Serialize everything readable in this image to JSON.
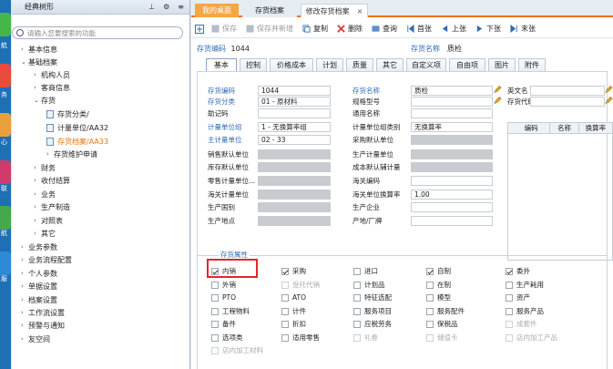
{
  "left_strip": {
    "labels": [
      "航",
      "务",
      "心",
      "联",
      "航",
      "服"
    ]
  },
  "tree": {
    "title": "经典树形",
    "search_placeholder": "请输入您要搜索的功能",
    "nodes": [
      {
        "label": "基本信息",
        "level": 0,
        "arrow": "›"
      },
      {
        "label": "基础档案",
        "level": 0,
        "arrow": "⌄"
      },
      {
        "label": "机构人员",
        "level": 1,
        "arrow": "›"
      },
      {
        "label": "客商信息",
        "level": 1,
        "arrow": "›"
      },
      {
        "label": "存货",
        "level": 1,
        "arrow": "⌄"
      },
      {
        "label": "存货分类/",
        "level": 2,
        "arrow": ""
      },
      {
        "label": "计量单位/AA32",
        "level": 2,
        "arrow": ""
      },
      {
        "label": "存货档案/AA33",
        "level": 2,
        "arrow": "",
        "active": true
      },
      {
        "label": "存货维护申请",
        "level": 2,
        "arrow": "›"
      },
      {
        "label": "财务",
        "level": 1,
        "arrow": "›"
      },
      {
        "label": "收付结算",
        "level": 1,
        "arrow": "›"
      },
      {
        "label": "业务",
        "level": 1,
        "arrow": "›"
      },
      {
        "label": "生产制造",
        "level": 1,
        "arrow": "›"
      },
      {
        "label": "对照表",
        "level": 1,
        "arrow": "›"
      },
      {
        "label": "其它",
        "level": 1,
        "arrow": "›"
      },
      {
        "label": "业务参数",
        "level": 0,
        "arrow": "›"
      },
      {
        "label": "业务流程配置",
        "level": 0,
        "arrow": "›"
      },
      {
        "label": "个人参数",
        "level": 0,
        "arrow": "›"
      },
      {
        "label": "单据设置",
        "level": 0,
        "arrow": "›"
      },
      {
        "label": "档案设置",
        "level": 0,
        "arrow": "›"
      },
      {
        "label": "工作流设置",
        "level": 0,
        "arrow": "›"
      },
      {
        "label": "预警与通知",
        "level": 0,
        "arrow": "›"
      },
      {
        "label": "友空间",
        "level": 0,
        "arrow": "›"
      }
    ]
  },
  "tabs": [
    "我的桌面",
    "存货档案",
    "修改存货档案"
  ],
  "toolbar": [
    "保存",
    "保存并新增",
    "复制",
    "删除",
    "查询",
    "首张",
    "上张",
    "下张",
    "末张"
  ],
  "header": {
    "code_label": "存货编码",
    "code_value": "1044",
    "name_label": "存货名称",
    "name_value": "质检"
  },
  "page_tabs": [
    "基本",
    "控制",
    "价格成本",
    "计划",
    "质量",
    "其它",
    "自定义项",
    "自由项",
    "图片",
    "附件"
  ],
  "form": {
    "col1": [
      {
        "label": "存货编码",
        "value": "1044",
        "req": true
      },
      {
        "label": "存货分类",
        "value": "01 - 原材料",
        "req": true
      },
      {
        "label": "助记码",
        "value": ""
      },
      {
        "label": "计量单位组",
        "value": "1 - 无换算率组",
        "req": true
      },
      {
        "label": "主计量单位",
        "value": "02 - 33",
        "req": true
      },
      {
        "label": "销售默认单位",
        "value": ""
      },
      {
        "label": "库存默认单位",
        "value": ""
      },
      {
        "label": "零售计量单位...",
        "value": ""
      },
      {
        "label": "海关计量单位",
        "value": ""
      },
      {
        "label": "生产国别",
        "value": ""
      },
      {
        "label": "生产地点",
        "value": ""
      }
    ],
    "col2": [
      {
        "label": "存货名称",
        "value": "质检",
        "req": true
      },
      {
        "label": "规格型号",
        "value": ""
      },
      {
        "label": "通用名称",
        "value": ""
      },
      {
        "label": "计量单位组类别",
        "value": "无换算率"
      },
      {
        "label": "采购默认单位",
        "value": ""
      },
      {
        "label": "生产计量单位",
        "value": ""
      },
      {
        "label": "成本默认辅计量",
        "value": ""
      },
      {
        "label": "海关编码",
        "value": ""
      },
      {
        "label": "海关单位换算率",
        "value": "1.00"
      },
      {
        "label": "生产企业",
        "value": ""
      },
      {
        "label": "产地/厂牌",
        "value": ""
      }
    ],
    "col3": [
      {
        "label": "英文名",
        "value": ""
      },
      {
        "label": "存货代码",
        "value": ""
      }
    ],
    "grid_headers": [
      "编码",
      "名称",
      "换算率"
    ]
  },
  "attributes": {
    "title": "存货属性",
    "items": [
      {
        "label": "内销",
        "checked": true,
        "disabled": false
      },
      {
        "label": "采购",
        "checked": true,
        "disabled": false
      },
      {
        "label": "进口",
        "checked": false,
        "disabled": false
      },
      {
        "label": "自制",
        "checked": true,
        "disabled": false
      },
      {
        "label": "委外",
        "checked": true,
        "disabled": false
      },
      {
        "label": "外销",
        "checked": false,
        "disabled": false
      },
      {
        "label": "受托代销",
        "checked": false,
        "disabled": true
      },
      {
        "label": "计划品",
        "checked": false,
        "disabled": false
      },
      {
        "label": "在制",
        "checked": false,
        "disabled": false
      },
      {
        "label": "生产耗用",
        "checked": false,
        "disabled": false
      },
      {
        "label": "PTO",
        "checked": false,
        "disabled": false
      },
      {
        "label": "ATO",
        "checked": false,
        "disabled": false
      },
      {
        "label": "特征选配",
        "checked": false,
        "disabled": false
      },
      {
        "label": "模型",
        "checked": false,
        "disabled": false
      },
      {
        "label": "资产",
        "checked": false,
        "disabled": false
      },
      {
        "label": "工程物料",
        "checked": false,
        "disabled": false
      },
      {
        "label": "计件",
        "checked": false,
        "disabled": false
      },
      {
        "label": "服务项目",
        "checked": false,
        "disabled": false
      },
      {
        "label": "服务配件",
        "checked": false,
        "disabled": false
      },
      {
        "label": "服务产品",
        "checked": false,
        "disabled": false
      },
      {
        "label": "备件",
        "checked": false,
        "disabled": false
      },
      {
        "label": "折扣",
        "checked": false,
        "disabled": false
      },
      {
        "label": "应税劳务",
        "checked": false,
        "disabled": false
      },
      {
        "label": "保税品",
        "checked": false,
        "disabled": false
      },
      {
        "label": "成套件",
        "checked": false,
        "disabled": true
      },
      {
        "label": "选项类",
        "checked": false,
        "disabled": false
      },
      {
        "label": "适用零售",
        "checked": false,
        "disabled": false
      },
      {
        "label": "礼券",
        "checked": false,
        "disabled": true
      },
      {
        "label": "储值卡",
        "checked": false,
        "disabled": true
      },
      {
        "label": "店内加工产品",
        "checked": false,
        "disabled": true
      },
      {
        "label": "店内加工材料",
        "checked": false,
        "disabled": true
      }
    ]
  },
  "colors": {
    "accent": "#ec7410",
    "label_blue": "#2f6bb4",
    "highlight_red": "#e3262a"
  }
}
